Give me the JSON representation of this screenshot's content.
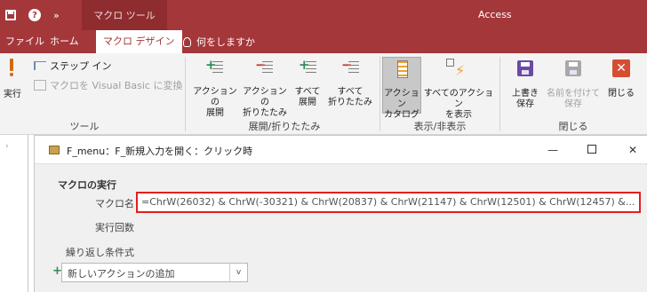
{
  "app": {
    "title": "Access",
    "context_tab": "マクロ ツール",
    "qat": {
      "more": "»"
    }
  },
  "tabs": {
    "file": "ファイル",
    "home": "ホーム",
    "macro_design": "マクロ デザイン",
    "tell_me": "何をしますか"
  },
  "ribbon": {
    "tools": {
      "label": "ツール",
      "run": "実行",
      "step_in": "ステップ イン",
      "convert_vb": "マクロを Visual Basic に変換"
    },
    "expand_collapse": {
      "label": "展開/折りたたみ",
      "expand_action": [
        "アクションの",
        "展開"
      ],
      "collapse_action": [
        "アクションの",
        "折りたたみ"
      ],
      "expand_all": [
        "すべて",
        "展開"
      ],
      "collapse_all": [
        "すべて",
        "折りたたみ"
      ]
    },
    "show_hide": {
      "label": "表示/非表示",
      "action_catalog": [
        "アクション",
        "カタログ"
      ],
      "show_all_actions": [
        "すべてのアクション",
        "を表示"
      ]
    },
    "close": {
      "label": "閉じる",
      "save": [
        "上書き",
        "保存"
      ],
      "save_as": [
        "名前を付けて",
        "保存"
      ],
      "close": "閉じる"
    }
  },
  "macro_window": {
    "title": "F_menu：F_新規入力を開く：クリック時",
    "min": "—",
    "close": "✕",
    "section_title": "マクロの実行",
    "macro_name_label": "マクロ名",
    "macro_name_value": "=ChrW(26032) & ChrW(-30321) & ChrW(20837) & ChrW(21147) & ChrW(12501) & ChrW(12457) &...",
    "repeat_count_label": "実行回数",
    "repeat_condition_label": "繰り返し条件式",
    "add_action_text": "新しいアクションの追加",
    "add_action_plus": "+",
    "dropdown_arrow": "v"
  }
}
